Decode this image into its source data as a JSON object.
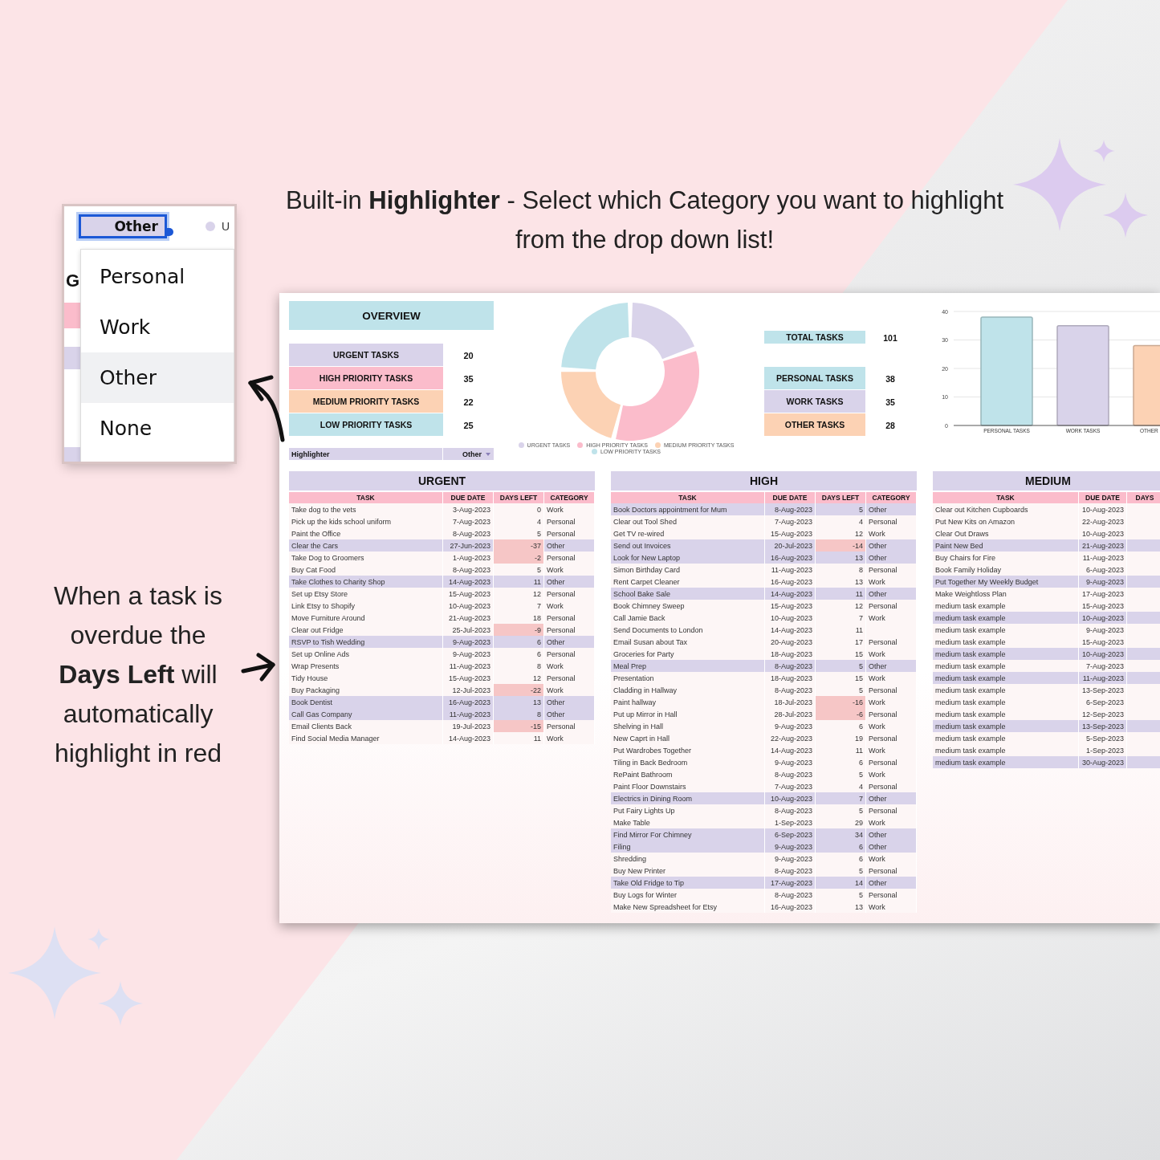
{
  "headline": "Built-in **Highlighter** - Select which Category you want to highlight from the drop down list!",
  "caption": "When a task is overdue the **Days Left** will automatically highlight in red",
  "dropdown_inset": {
    "partial_heading": "G",
    "partial_legend": "U",
    "field_value": "Other",
    "options": [
      {
        "label": "Personal",
        "selected": false
      },
      {
        "label": "Work",
        "selected": false
      },
      {
        "label": "Other",
        "selected": true
      },
      {
        "label": "None",
        "selected": false
      }
    ]
  },
  "sheet": {
    "overview": {
      "title": "OVERVIEW",
      "stats": [
        {
          "label": "URGENT TASKS",
          "value": "20",
          "color": "#d9d3ea"
        },
        {
          "label": "HIGH PRIORITY TASKS",
          "value": "35",
          "color": "#fbbccb"
        },
        {
          "label": "MEDIUM PRIORITY TASKS",
          "value": "22",
          "color": "#fcd2b4"
        },
        {
          "label": "LOW PRIORITY TASKS",
          "value": "25",
          "color": "#bfe3ea"
        }
      ],
      "highlighter": {
        "label": "Highlighter",
        "value": "Other"
      }
    },
    "priority_chart": {
      "chart_data": {
        "type": "donut",
        "categories": [
          "URGENT TASKS",
          "HIGH PRIORITY TASKS",
          "MEDIUM PRIORITY TASKS",
          "LOW PRIORITY TASKS"
        ],
        "values": [
          19.6,
          34.3,
          21.6,
          24.5
        ],
        "colors": [
          "#d9d3ea",
          "#fbbccb",
          "#fcd2b4",
          "#bfe3ea"
        ],
        "legend": "bottom"
      }
    },
    "totals": [
      {
        "label": "TOTAL TASKS",
        "value": "101",
        "color": "#bfe3ea"
      }
    ],
    "category_stats": [
      {
        "label": "PERSONAL TASKS",
        "value": "38",
        "color": "#bfe3ea"
      },
      {
        "label": "WORK TASKS",
        "value": "35",
        "color": "#d9d3ea"
      },
      {
        "label": "OTHER TASKS",
        "value": "28",
        "color": "#fcd2b4"
      }
    ],
    "category_chart": {
      "chart_data": {
        "type": "bar",
        "categories": [
          "PERSONAL TASKS",
          "WORK TASKS",
          "OTHER"
        ],
        "values": [
          38,
          35,
          28
        ],
        "colors": [
          "#bfe3ea",
          "#d9d3ea",
          "#fcd2b4"
        ],
        "ylim": [
          0,
          40
        ],
        "yticks": [
          0,
          10,
          20,
          30,
          40
        ],
        "grid": true
      }
    },
    "tables": [
      {
        "title": "URGENT",
        "columns": [
          "TASK",
          "DUE DATE",
          "DAYS LEFT",
          "CATEGORY"
        ],
        "rows": [
          {
            "cells": [
              "Take dog to the vets",
              "3-Aug-2023",
              "0",
              "Work"
            ],
            "highlighted": false,
            "overdue": false
          },
          {
            "cells": [
              "Pick up the kids school uniform",
              "7-Aug-2023",
              "4",
              "Personal"
            ],
            "highlighted": false,
            "overdue": false
          },
          {
            "cells": [
              "Paint the Office",
              "8-Aug-2023",
              "5",
              "Personal"
            ],
            "highlighted": false,
            "overdue": false
          },
          {
            "cells": [
              "Clear the Cars",
              "27-Jun-2023",
              "-37",
              "Other"
            ],
            "highlighted": true,
            "overdue": true
          },
          {
            "cells": [
              "Take Dog to Groomers",
              "1-Aug-2023",
              "-2",
              "Personal"
            ],
            "highlighted": false,
            "overdue": true
          },
          {
            "cells": [
              "Buy Cat Food",
              "8-Aug-2023",
              "5",
              "Work"
            ],
            "highlighted": false,
            "overdue": false
          },
          {
            "cells": [
              "Take Clothes to Charity Shop",
              "14-Aug-2023",
              "11",
              "Other"
            ],
            "highlighted": true,
            "overdue": false
          },
          {
            "cells": [
              "Set up Etsy Store",
              "15-Aug-2023",
              "12",
              "Personal"
            ],
            "highlighted": false,
            "overdue": false
          },
          {
            "cells": [
              "Link Etsy to Shopify",
              "10-Aug-2023",
              "7",
              "Work"
            ],
            "highlighted": false,
            "overdue": false
          },
          {
            "cells": [
              "Move Furniture Around",
              "21-Aug-2023",
              "18",
              "Personal"
            ],
            "highlighted": false,
            "overdue": false
          },
          {
            "cells": [
              "Clear out Fridge",
              "25-Jul-2023",
              "-9",
              "Personal"
            ],
            "highlighted": false,
            "overdue": true
          },
          {
            "cells": [
              "RSVP to Tish Wedding",
              "9-Aug-2023",
              "6",
              "Other"
            ],
            "highlighted": true,
            "overdue": false
          },
          {
            "cells": [
              "Set up Online Ads",
              "9-Aug-2023",
              "6",
              "Personal"
            ],
            "highlighted": false,
            "overdue": false
          },
          {
            "cells": [
              "Wrap Presents",
              "11-Aug-2023",
              "8",
              "Work"
            ],
            "highlighted": false,
            "overdue": false
          },
          {
            "cells": [
              "Tidy House",
              "15-Aug-2023",
              "12",
              "Personal"
            ],
            "highlighted": false,
            "overdue": false
          },
          {
            "cells": [
              "Buy Packaging",
              "12-Jul-2023",
              "-22",
              "Work"
            ],
            "highlighted": false,
            "overdue": true
          },
          {
            "cells": [
              "Book Dentist",
              "16-Aug-2023",
              "13",
              "Other"
            ],
            "highlighted": true,
            "overdue": false
          },
          {
            "cells": [
              "Call Gas Company",
              "11-Aug-2023",
              "8",
              "Other"
            ],
            "highlighted": true,
            "overdue": false
          },
          {
            "cells": [
              "Email Clients Back",
              "19-Jul-2023",
              "-15",
              "Personal"
            ],
            "highlighted": false,
            "overdue": true
          },
          {
            "cells": [
              "Find Social Media Manager",
              "14-Aug-2023",
              "11",
              "Work"
            ],
            "highlighted": false,
            "overdue": false
          }
        ]
      },
      {
        "title": "HIGH",
        "columns": [
          "TASK",
          "DUE DATE",
          "DAYS LEFT",
          "CATEGORY"
        ],
        "rows": [
          {
            "cells": [
              "Book Doctors appointment for Mum",
              "8-Aug-2023",
              "5",
              "Other"
            ],
            "highlighted": true,
            "overdue": false
          },
          {
            "cells": [
              "Clear out Tool Shed",
              "7-Aug-2023",
              "4",
              "Personal"
            ],
            "highlighted": false,
            "overdue": false
          },
          {
            "cells": [
              "Get TV re-wired",
              "15-Aug-2023",
              "12",
              "Work"
            ],
            "highlighted": false,
            "overdue": false
          },
          {
            "cells": [
              "Send out Invoices",
              "20-Jul-2023",
              "-14",
              "Other"
            ],
            "highlighted": true,
            "overdue": true
          },
          {
            "cells": [
              "Look for New Laptop",
              "16-Aug-2023",
              "13",
              "Other"
            ],
            "highlighted": true,
            "overdue": false
          },
          {
            "cells": [
              "Simon Birthday Card",
              "11-Aug-2023",
              "8",
              "Personal"
            ],
            "highlighted": false,
            "overdue": false
          },
          {
            "cells": [
              "Rent Carpet Cleaner",
              "16-Aug-2023",
              "13",
              "Work"
            ],
            "highlighted": false,
            "overdue": false
          },
          {
            "cells": [
              "School Bake Sale",
              "14-Aug-2023",
              "11",
              "Other"
            ],
            "highlighted": true,
            "overdue": false
          },
          {
            "cells": [
              "Book Chimney Sweep",
              "15-Aug-2023",
              "12",
              "Personal"
            ],
            "highlighted": false,
            "overdue": false
          },
          {
            "cells": [
              "Call Jamie Back",
              "10-Aug-2023",
              "7",
              "Work"
            ],
            "highlighted": false,
            "overdue": false
          },
          {
            "cells": [
              "Send Documents to London",
              "14-Aug-2023",
              "11"
            ],
            "highlighted": false,
            "overdue": false
          },
          {
            "cells": [
              "Email Susan about Tax",
              "20-Aug-2023",
              "17",
              "Personal"
            ],
            "highlighted": false,
            "overdue": false
          },
          {
            "cells": [
              "Groceries for Party",
              "18-Aug-2023",
              "15",
              "Work"
            ],
            "highlighted": false,
            "overdue": false
          },
          {
            "cells": [
              "Meal Prep",
              "8-Aug-2023",
              "5",
              "Other"
            ],
            "highlighted": true,
            "overdue": false
          },
          {
            "cells": [
              "Presentation",
              "18-Aug-2023",
              "15",
              "Work"
            ],
            "highlighted": false,
            "overdue": false
          },
          {
            "cells": [
              "Cladding in Hallway",
              "8-Aug-2023",
              "5",
              "Personal"
            ],
            "highlighted": false,
            "overdue": false
          },
          {
            "cells": [
              "Paint hallway",
              "18-Jul-2023",
              "-16",
              "Work"
            ],
            "highlighted": false,
            "overdue": true
          },
          {
            "cells": [
              "Put up Mirror in Hall",
              "28-Jul-2023",
              "-6",
              "Personal"
            ],
            "highlighted": false,
            "overdue": true
          },
          {
            "cells": [
              "Shelving in Hall",
              "9-Aug-2023",
              "6",
              "Work"
            ],
            "highlighted": false,
            "overdue": false
          },
          {
            "cells": [
              "New Caprt in Hall",
              "22-Aug-2023",
              "19",
              "Personal"
            ],
            "highlighted": false,
            "overdue": false
          },
          {
            "cells": [
              "Put Wardrobes Together",
              "14-Aug-2023",
              "11",
              "Work"
            ],
            "highlighted": false,
            "overdue": false
          },
          {
            "cells": [
              "Tiling in Back Bedroom",
              "9-Aug-2023",
              "6",
              "Personal"
            ],
            "highlighted": false,
            "overdue": false
          },
          {
            "cells": [
              "RePaint Bathroom",
              "8-Aug-2023",
              "5",
              "Work"
            ],
            "highlighted": false,
            "overdue": false
          },
          {
            "cells": [
              "Paint Floor Downstairs",
              "7-Aug-2023",
              "4",
              "Personal"
            ],
            "highlighted": false,
            "overdue": false
          },
          {
            "cells": [
              "Electrics in Dining Room",
              "10-Aug-2023",
              "7",
              "Other"
            ],
            "highlighted": true,
            "overdue": false
          },
          {
            "cells": [
              "Put Fairy Lights Up",
              "8-Aug-2023",
              "5",
              "Personal"
            ],
            "highlighted": false,
            "overdue": false
          },
          {
            "cells": [
              "Make Table",
              "1-Sep-2023",
              "29",
              "Work"
            ],
            "highlighted": false,
            "overdue": false
          },
          {
            "cells": [
              "Find Mirror For Chimney",
              "6-Sep-2023",
              "34",
              "Other"
            ],
            "highlighted": true,
            "overdue": false
          },
          {
            "cells": [
              "Filing",
              "9-Aug-2023",
              "6",
              "Other"
            ],
            "highlighted": true,
            "overdue": false
          },
          {
            "cells": [
              "Shredding",
              "9-Aug-2023",
              "6",
              "Work"
            ],
            "highlighted": false,
            "overdue": false
          },
          {
            "cells": [
              "Buy New Printer",
              "8-Aug-2023",
              "5",
              "Personal"
            ],
            "highlighted": false,
            "overdue": false
          },
          {
            "cells": [
              "Take Old Fridge to Tip",
              "17-Aug-2023",
              "14",
              "Other"
            ],
            "highlighted": true,
            "overdue": false
          },
          {
            "cells": [
              "Buy Logs for Winter",
              "8-Aug-2023",
              "5",
              "Personal"
            ],
            "highlighted": false,
            "overdue": false
          },
          {
            "cells": [
              "Make New Spreadsheet for Etsy",
              "16-Aug-2023",
              "13",
              "Work"
            ],
            "highlighted": false,
            "overdue": false
          }
        ]
      },
      {
        "title": "MEDIUM",
        "columns": [
          "TASK",
          "DUE DATE",
          "DAYS"
        ],
        "rows": [
          {
            "cells": [
              "Clear out Kitchen Cupboards",
              "10-Aug-2023"
            ],
            "highlighted": false
          },
          {
            "cells": [
              "Put New Kits on Amazon",
              "22-Aug-2023"
            ],
            "highlighted": false
          },
          {
            "cells": [
              "Clear Out Draws",
              "10-Aug-2023"
            ],
            "highlighted": false
          },
          {
            "cells": [
              "Paint New Bed",
              "21-Aug-2023"
            ],
            "highlighted": true
          },
          {
            "cells": [
              "Buy Chairs for Fire",
              "11-Aug-2023"
            ],
            "highlighted": false
          },
          {
            "cells": [
              "Book Family Holiday",
              "6-Aug-2023"
            ],
            "highlighted": false
          },
          {
            "cells": [
              "Put Together My Weekly Budget",
              "9-Aug-2023"
            ],
            "highlighted": true
          },
          {
            "cells": [
              "Make Weightloss Plan",
              "17-Aug-2023"
            ],
            "highlighted": false
          },
          {
            "cells": [
              "medium task example",
              "15-Aug-2023"
            ],
            "highlighted": false
          },
          {
            "cells": [
              "medium task example",
              "10-Aug-2023"
            ],
            "highlighted": true
          },
          {
            "cells": [
              "medium task example",
              "9-Aug-2023"
            ],
            "highlighted": false
          },
          {
            "cells": [
              "medium task example",
              "15-Aug-2023"
            ],
            "highlighted": false
          },
          {
            "cells": [
              "medium task example",
              "10-Aug-2023"
            ],
            "highlighted": true
          },
          {
            "cells": [
              "medium task example",
              "7-Aug-2023"
            ],
            "highlighted": false
          },
          {
            "cells": [
              "medium task example",
              "11-Aug-2023"
            ],
            "highlighted": true
          },
          {
            "cells": [
              "medium task example",
              "13-Sep-2023"
            ],
            "highlighted": false
          },
          {
            "cells": [
              "medium task example",
              "6-Sep-2023"
            ],
            "highlighted": false
          },
          {
            "cells": [
              "medium task example",
              "12-Sep-2023"
            ],
            "highlighted": false
          },
          {
            "cells": [
              "medium task example",
              "13-Sep-2023"
            ],
            "highlighted": true
          },
          {
            "cells": [
              "medium task example",
              "5-Sep-2023"
            ],
            "highlighted": false
          },
          {
            "cells": [
              "medium task example",
              "1-Sep-2023"
            ],
            "highlighted": false
          },
          {
            "cells": [
              "medium task example",
              "30-Aug-2023"
            ],
            "highlighted": true
          }
        ]
      }
    ]
  }
}
